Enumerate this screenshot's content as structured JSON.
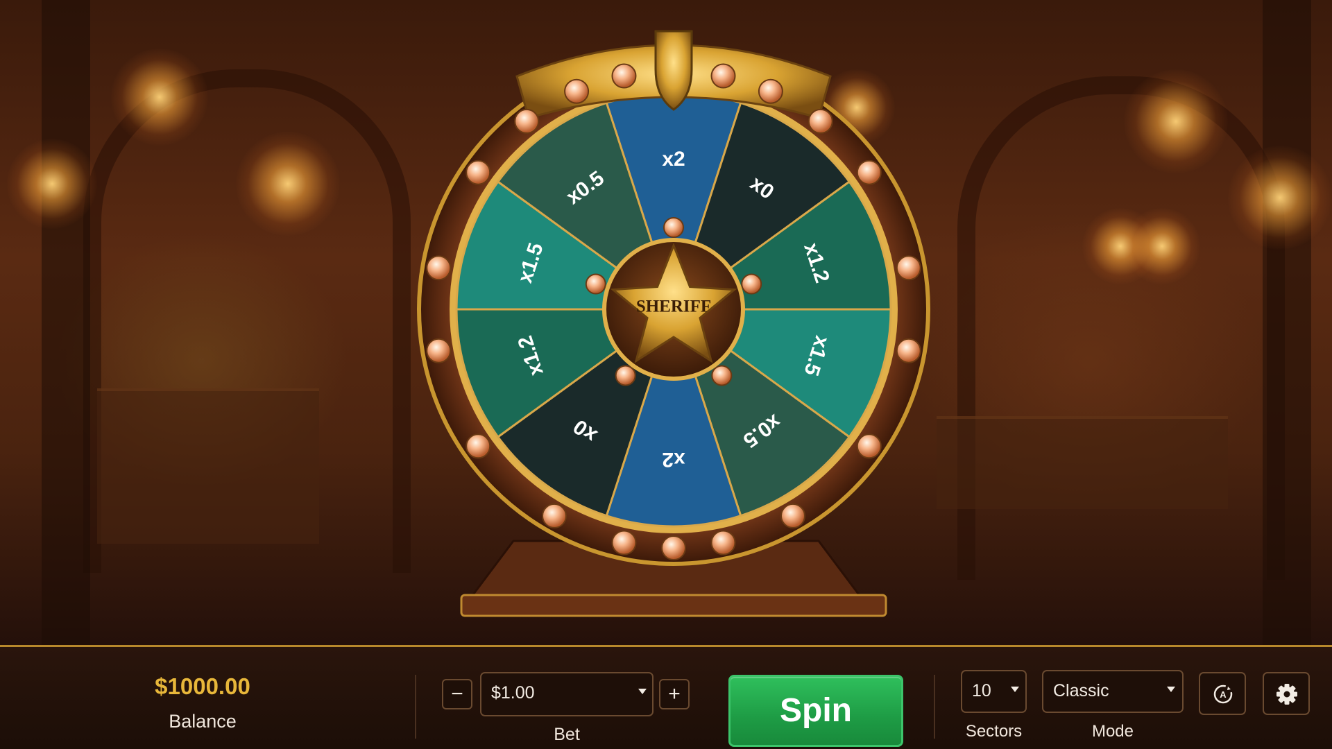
{
  "wheel": {
    "sectors": [
      {
        "label": "x2",
        "color": "#1f5f95"
      },
      {
        "label": "x0",
        "color": "#1a2a2a"
      },
      {
        "label": "x1.2",
        "color": "#1a6a55"
      },
      {
        "label": "x1.5",
        "color": "#1e8a7a"
      },
      {
        "label": "x0.5",
        "color": "#2a5a4a"
      },
      {
        "label": "x2",
        "color": "#1f5f95"
      },
      {
        "label": "x0",
        "color": "#1a2a2a"
      },
      {
        "label": "x1.2",
        "color": "#1a6a55"
      },
      {
        "label": "x1.5",
        "color": "#1e8a7a"
      },
      {
        "label": "x0.5",
        "color": "#2a5a4a"
      }
    ],
    "center_badge": "SHERIFF",
    "pointer_icon": "bullet-pointer-icon"
  },
  "bottom_bar": {
    "balance_amount": "$1000.00",
    "balance_label": "Balance",
    "bet_value": "$1.00",
    "bet_label": "Bet",
    "decrease_label": "−",
    "increase_label": "+",
    "spin_label": "Spin",
    "sectors_value": "10",
    "sectors_label": "Sectors",
    "mode_value": "Classic",
    "mode_label": "Mode",
    "autoplay_icon": "autoplay-icon",
    "settings_icon": "gear-icon"
  },
  "colors": {
    "accent_gold": "#e8b73a",
    "spin_green": "#22a84c"
  }
}
